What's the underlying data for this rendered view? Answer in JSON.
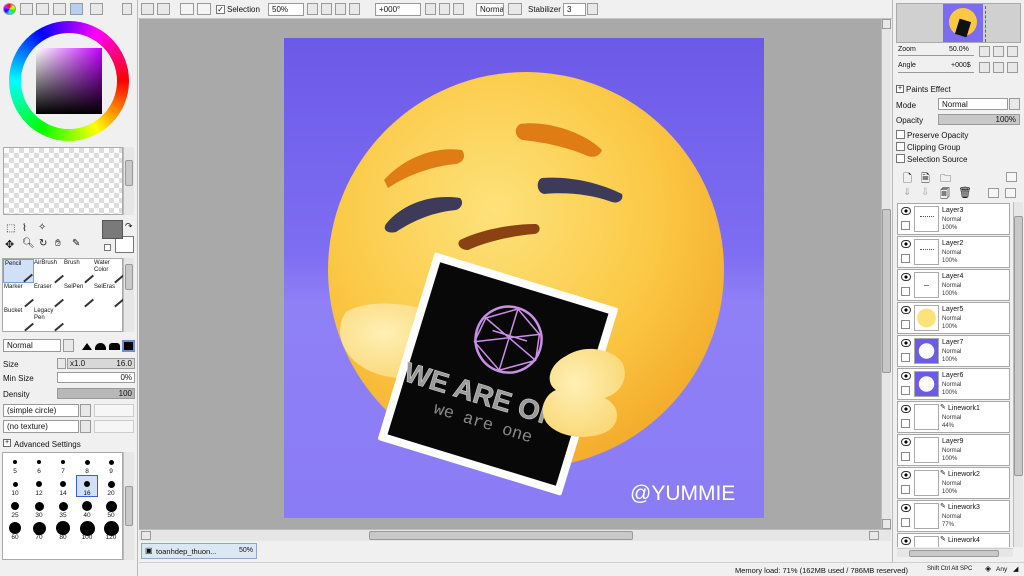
{
  "toolbar": {
    "selection_label": "Selection",
    "zoom_value": "50%",
    "angle_value": "+000°",
    "blend_mode": "Normal",
    "stabilizer_label": "Stabilizer",
    "stabilizer_value": "3"
  },
  "tools": {
    "brush_tools": [
      {
        "label": "Pencil",
        "icon": "pencil-icon"
      },
      {
        "label": "AirBrush",
        "icon": "airbrush-icon"
      },
      {
        "label": "Brush",
        "icon": "brush-icon"
      },
      {
        "label": "Water Color",
        "icon": "watercolor-icon"
      },
      {
        "label": "Marker",
        "icon": "marker-icon"
      },
      {
        "label": "Eraser",
        "icon": "eraser-icon"
      },
      {
        "label": "SelPen",
        "icon": "selpen-icon"
      },
      {
        "label": "SelEras",
        "icon": "seleras-icon"
      },
      {
        "label": "Bucket",
        "icon": "bucket-icon"
      },
      {
        "label": "Legacy Pen",
        "icon": "legacy-pen-icon"
      }
    ],
    "mode": "Normal",
    "size_label": "Size",
    "size_multiplier": "x1.0",
    "size_value": "16.0",
    "min_size_label": "Min Size",
    "min_size_value": "0%",
    "density_label": "Density",
    "density_value": "100",
    "shape": "(simple circle)",
    "texture": "(no texture)",
    "advanced_label": "Advanced Settings",
    "brush_sizes": [
      "5",
      "6",
      "7",
      "8",
      "9",
      "10",
      "12",
      "14",
      "16",
      "20",
      "25",
      "30",
      "35",
      "40",
      "50",
      "60",
      "70",
      "80",
      "100",
      "120"
    ],
    "selected_brush_size": "16"
  },
  "canvas": {
    "tab_label": "toanhdep_thuon...",
    "tab_zoom": "50%",
    "bg_color": "#7b6cf0",
    "card_line1": "WE ARE ONE",
    "card_line2": "we are one",
    "watermark": "@YUMMIE"
  },
  "navigator": {
    "zoom_label": "Zoom",
    "zoom_value": "50.0%",
    "angle_label": "Angle",
    "angle_value": "+000$"
  },
  "layer_props": {
    "paints_effect_label": "Paints Effect",
    "mode_label": "Mode",
    "mode_value": "Normal",
    "opacity_label": "Opacity",
    "opacity_value": "100%",
    "preserve_opacity": "Preserve Opacity",
    "clipping_group": "Clipping Group",
    "selection_source": "Selection Source"
  },
  "layers": [
    {
      "name": "Layer3",
      "mode": "Normal",
      "opacity": "100%",
      "thumb": "lines"
    },
    {
      "name": "Layer2",
      "mode": "Normal",
      "opacity": "100%",
      "thumb": "lines"
    },
    {
      "name": "Layer4",
      "mode": "Normal",
      "opacity": "100%",
      "thumb": "dash"
    },
    {
      "name": "Layer5",
      "mode": "Normal",
      "opacity": "100%",
      "thumb": "yellow"
    },
    {
      "name": "Layer7",
      "mode": "Normal",
      "opacity": "100%",
      "thumb": "purple"
    },
    {
      "name": "Layer6",
      "mode": "Normal",
      "opacity": "100%",
      "thumb": "purple"
    },
    {
      "name": "Linework1",
      "mode": "Normal",
      "opacity": "44%",
      "thumb": "blank"
    },
    {
      "name": "Layer9",
      "mode": "Normal",
      "opacity": "100%",
      "thumb": "blank"
    },
    {
      "name": "Linework2",
      "mode": "Normal",
      "opacity": "100%",
      "thumb": "blank"
    },
    {
      "name": "Linework3",
      "mode": "Normal",
      "opacity": "77%",
      "thumb": "blank"
    },
    {
      "name": "Linework4",
      "mode": "",
      "opacity": "",
      "thumb": "blank"
    }
  ],
  "status": {
    "memory": "Memory load: 71% (162MB used / 786MB reserved)",
    "keys": "Shift Ctrl Alt SPC",
    "any": "Any"
  },
  "colors": {
    "current_color": "#7a7a7a",
    "panel": "#f0f0f0",
    "workspace": "#a9a9a9"
  }
}
